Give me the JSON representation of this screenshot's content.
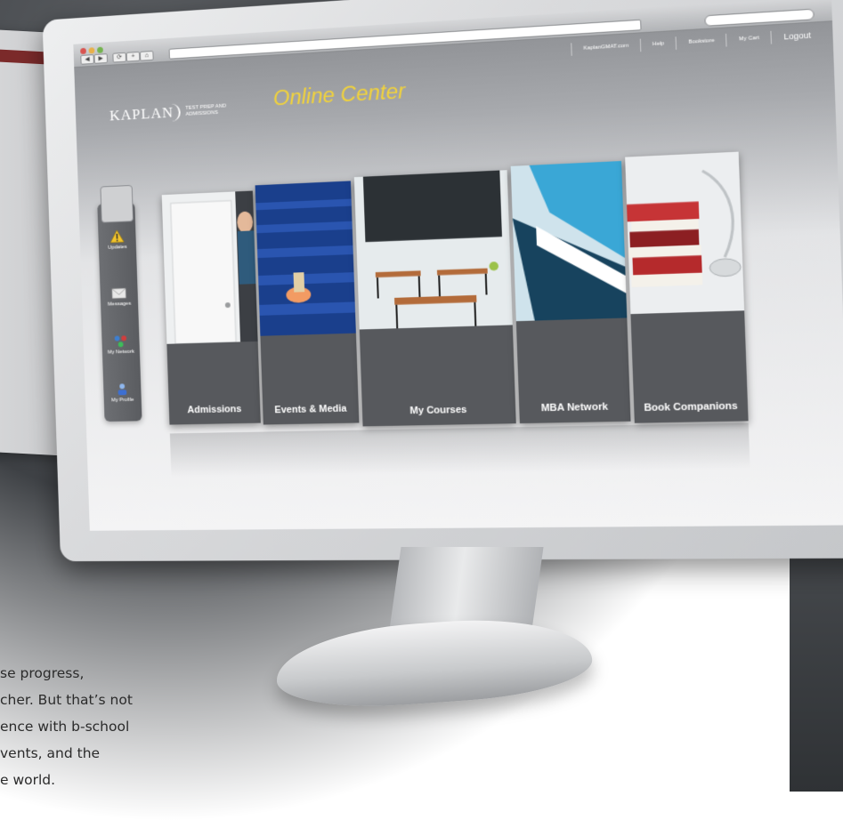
{
  "browser": {
    "nav_back": "◀",
    "nav_forward": "▶"
  },
  "header": {
    "logo_word": "KAPLAN",
    "logo_tagline": "TEST PREP AND ADMISSIONS",
    "title": "Online Center",
    "nav": [
      {
        "label": "KaplanGMAT.com"
      },
      {
        "label": "Help"
      },
      {
        "label": "Bookstore"
      },
      {
        "label": "My Cart"
      },
      {
        "label": "Logout"
      }
    ]
  },
  "sidebar": {
    "items": [
      {
        "label": "Updates",
        "icon": "warning-icon"
      },
      {
        "label": "Messages",
        "icon": "envelope-icon"
      },
      {
        "label": "My Network",
        "icon": "network-icon"
      },
      {
        "label": "My Profile",
        "icon": "profile-icon"
      }
    ]
  },
  "tiles": [
    {
      "label": "Admissions"
    },
    {
      "label": "Events & Media"
    },
    {
      "label": "My Courses"
    },
    {
      "label": "MBA Network"
    },
    {
      "label": "Book Companions"
    }
  ],
  "copy": {
    "lines": [
      "se progress,",
      "cher. But that’s not",
      "ence with b-school",
      "vents, and the",
      "e world."
    ]
  },
  "colors": {
    "title_yellow": "#f2d33a",
    "tile_gray": "#57595d",
    "rail_gray": "#616367"
  }
}
